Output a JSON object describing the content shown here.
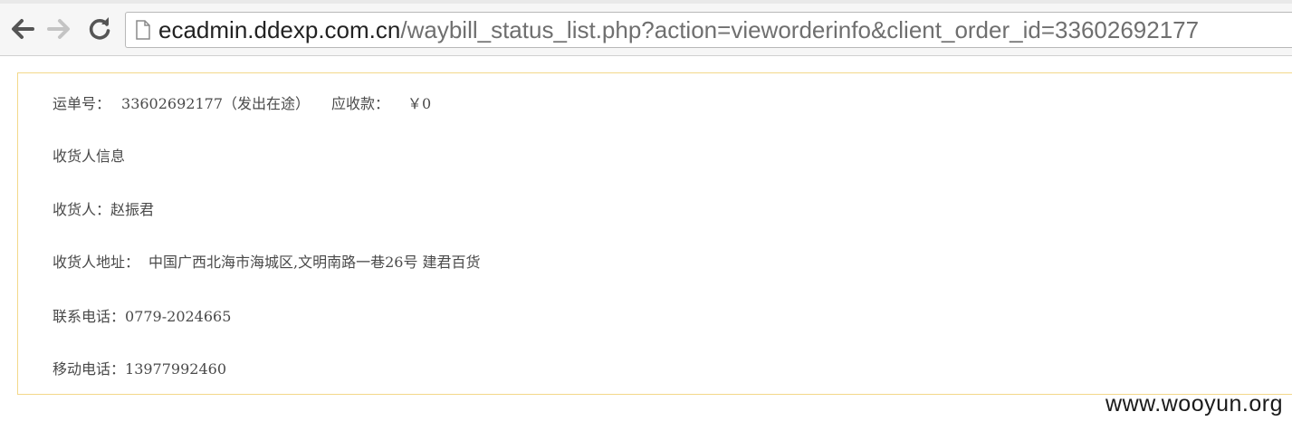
{
  "browser": {
    "url_host": "ecadmin.ddexp.com.cn",
    "url_path": "/waybill_status_list.php?action=vieworderinfo&client_order_id=33602692177"
  },
  "order": {
    "waybill_label": "运单号：",
    "waybill_value": "33602692177（发出在途）",
    "receivable_label": "应收款：",
    "receivable_value": "￥0",
    "section_title": "收货人信息",
    "consignee_label": "收货人：",
    "consignee_value": "赵振君",
    "address_label": "收货人地址：",
    "address_value": "中国广西北海市海城区,文明南路一巷26号 建君百货",
    "phone_label": "联系电话：",
    "phone_value": "0779-2024665",
    "mobile_label": "移动电话：",
    "mobile_value": "13977992460"
  },
  "watermark": "www.wooyun.org"
}
